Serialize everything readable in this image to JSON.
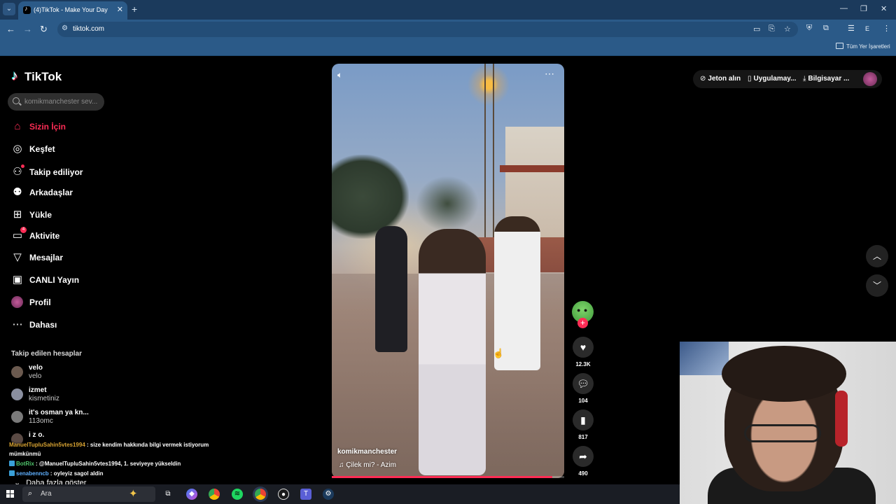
{
  "browser": {
    "tab_title": "(4)TikTok - Make Your Day",
    "url": "tiktok.com",
    "bookmarks_label": "Tüm Yer İşaretleri"
  },
  "tiktok": {
    "logo": "TikTok",
    "search_placeholder": "komikmanchester sev...",
    "nav": [
      {
        "label": "Sizin İçin",
        "icon": "home-icon",
        "active": true
      },
      {
        "label": "Keşfet",
        "icon": "compass-icon"
      },
      {
        "label": "Takip ediliyor",
        "icon": "following-icon"
      },
      {
        "label": "Arkadaşlar",
        "icon": "friends-icon"
      },
      {
        "label": "Yükle",
        "icon": "upload-icon"
      },
      {
        "label": "Aktivite",
        "icon": "activity-icon",
        "badge": "4"
      },
      {
        "label": "Mesajlar",
        "icon": "messages-icon"
      },
      {
        "label": "CANLI Yayın",
        "icon": "live-icon"
      },
      {
        "label": "Profil",
        "icon": "profile-avatar"
      },
      {
        "label": "Dahası",
        "icon": "more-icon"
      }
    ],
    "following_header": "Takip edilen hesaplar",
    "following": [
      {
        "name": "velo",
        "username": "velo"
      },
      {
        "name": "izmet",
        "username": "kismetiniz"
      },
      {
        "name": "it's osman ya kn...",
        "username": "113omc"
      },
      {
        "name": "i z o.",
        "username": ""
      }
    ],
    "show_more": "Daha fazla göster",
    "header": {
      "coins": "Jeton alın",
      "app": "Uygulamay...",
      "desktop": "Bilgisayar ..."
    },
    "video": {
      "author": "komikmanchester",
      "music": "Çilek mi? - Azim",
      "likes": "12.3K",
      "comments": "104",
      "saves": "817",
      "shares": "490",
      "progress_fraction": 0.95
    }
  },
  "chat": [
    {
      "user": "ManuelTupluSahin5vtes1994",
      "text": " : size kendim hakkında bilgi vermek istiyorum"
    },
    {
      "user": "",
      "text": "mümkünmü"
    },
    {
      "user": "BotRix",
      "text": " : @ManuelTupluSahin5vtes1994, 1. seviyeye yükseldin"
    },
    {
      "user": "senabenncb",
      "text": " : oyleyiz sagol aldin"
    }
  ],
  "taskbar": {
    "search_placeholder": "Ara"
  }
}
